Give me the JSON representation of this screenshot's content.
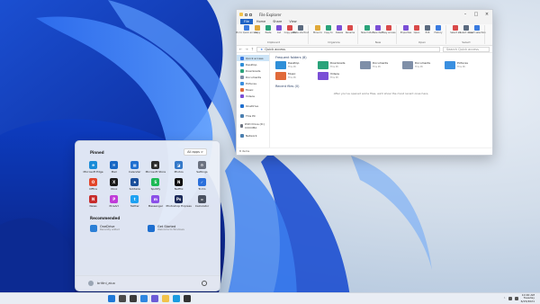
{
  "explorer": {
    "title": "File Explorer",
    "ribbon_tabs": [
      "File",
      "Home",
      "Share",
      "View"
    ],
    "ribbon_groups": [
      {
        "label": "Clipboard",
        "items": [
          "Pin to Quick access",
          "Copy",
          "Paste",
          "Cut",
          "Copy path",
          "Paste shortcut"
        ]
      },
      {
        "label": "Organize",
        "items": [
          "Move to",
          "Copy to",
          "Delete",
          "Rename"
        ]
      },
      {
        "label": "New",
        "items": [
          "New folder",
          "New item",
          "Easy access"
        ]
      },
      {
        "label": "Open",
        "items": [
          "Properties",
          "Open",
          "Edit",
          "History"
        ]
      },
      {
        "label": "Select",
        "items": [
          "Select all",
          "Select none",
          "Invert selection"
        ]
      }
    ],
    "address": "Quick access",
    "search_placeholder": "Search Quick access",
    "nav_items": [
      {
        "label": "Quick access",
        "selected": true
      },
      {
        "label": "Desktop"
      },
      {
        "label": "Downloads"
      },
      {
        "label": "Documents"
      },
      {
        "label": "Pictures"
      },
      {
        "label": "Music"
      },
      {
        "label": "Videos"
      },
      {
        "label": "OneDrive",
        "gap": true
      },
      {
        "label": "This PC",
        "gap": true
      },
      {
        "label": "DVD Drive (D:) CCCOMA",
        "gap": true
      },
      {
        "label": "Network",
        "gap": true
      }
    ],
    "frequent_header": "Frequent folders (8)",
    "folders": [
      {
        "name": "Desktop",
        "sub": "This PC",
        "color": "#2f8fd8"
      },
      {
        "name": "Downloads",
        "sub": "This PC",
        "color": "#2aa37a"
      },
      {
        "name": "Documents",
        "sub": "This PC",
        "color": "#7f8fa8"
      },
      {
        "name": "Documents",
        "sub": "This PC",
        "color": "#7f8fa8"
      },
      {
        "name": "Pictures",
        "sub": "This PC",
        "color": "#3a8fe0"
      },
      {
        "name": "Music",
        "sub": "This PC",
        "color": "#e06a3a"
      },
      {
        "name": "Videos",
        "sub": "This PC",
        "color": "#7a4fd6"
      }
    ],
    "recent_header": "Recent files (0)",
    "empty_message": "After you've opened some files, we'll show the most recent ones here.",
    "status": "8 items"
  },
  "start": {
    "pinned_label": "Pinned",
    "all_apps_label": "All apps >",
    "apps": [
      {
        "name": "Microsoft Edge",
        "color": "#1a8cd8",
        "glyph": "e"
      },
      {
        "name": "Mail",
        "color": "#1767c4",
        "glyph": "✉"
      },
      {
        "name": "Calendar",
        "color": "#1f6fd0",
        "glyph": "▦"
      },
      {
        "name": "Microsoft Store",
        "color": "#2b2b2b",
        "glyph": "▣"
      },
      {
        "name": "Photos",
        "color": "#3479c9",
        "glyph": "◪"
      },
      {
        "name": "Settings",
        "color": "#6b7280",
        "glyph": "⚙"
      },
      {
        "name": "Office",
        "color": "#e2452a",
        "glyph": "O"
      },
      {
        "name": "Xbox",
        "color": "#1a1a1a",
        "glyph": "X"
      },
      {
        "name": "Solitaire",
        "color": "#1b4f9a",
        "glyph": "♠"
      },
      {
        "name": "Spotify",
        "color": "#1db954",
        "glyph": "S"
      },
      {
        "name": "Netflix",
        "color": "#111111",
        "glyph": "N"
      },
      {
        "name": "To Do",
        "color": "#2a6fdb",
        "glyph": "✓"
      },
      {
        "name": "News",
        "color": "#c72c2c",
        "glyph": "N"
      },
      {
        "name": "PicsArt",
        "color": "#c03bd8",
        "glyph": "P"
      },
      {
        "name": "Twitter",
        "color": "#1da1f2",
        "glyph": "t"
      },
      {
        "name": "Messenger",
        "color": "#8b4fe8",
        "glyph": "m"
      },
      {
        "name": "Photoshop Express",
        "color": "#1b2a5a",
        "glyph": "Ps"
      },
      {
        "name": "Calculator",
        "color": "#4a5160",
        "glyph": "="
      }
    ],
    "recommended_label": "Recommended",
    "recommended": [
      {
        "title": "OneDrive",
        "sub": "Recently added",
        "color": "#2b7fd6"
      },
      {
        "title": "Get Started",
        "sub": "Welcome to Windows",
        "color": "#1e6fd0"
      }
    ],
    "user_name": "brittni_aiuo"
  },
  "taskbar": {
    "icons": [
      {
        "name": "start",
        "color": "#1f78d6"
      },
      {
        "name": "search",
        "color": "#4a4a4a"
      },
      {
        "name": "task-view",
        "color": "#3b3b3b"
      },
      {
        "name": "widgets",
        "color": "#2f86e0"
      },
      {
        "name": "chat",
        "color": "#6b5bd6"
      },
      {
        "name": "file-explorer",
        "color": "#f1c24a"
      },
      {
        "name": "edge",
        "color": "#1a9be0"
      },
      {
        "name": "store",
        "color": "#333333"
      }
    ],
    "time": "10:00 AM",
    "day": "Tuesday",
    "date": "6/15/2021"
  }
}
